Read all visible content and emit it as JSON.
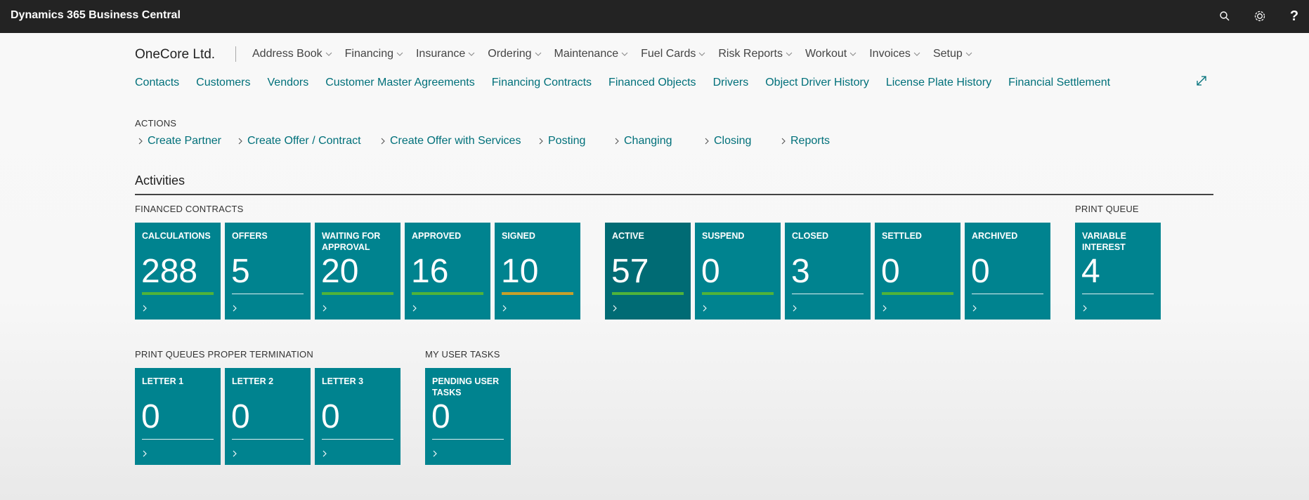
{
  "app": {
    "title": "Dynamics 365 Business Central"
  },
  "topbar": {
    "help": "?"
  },
  "company": "OneCore Ltd.",
  "menu": [
    {
      "label": "Address Book"
    },
    {
      "label": "Financing"
    },
    {
      "label": "Insurance"
    },
    {
      "label": "Ordering"
    },
    {
      "label": "Maintenance"
    },
    {
      "label": "Fuel Cards"
    },
    {
      "label": "Risk Reports"
    },
    {
      "label": "Workout"
    },
    {
      "label": "Invoices"
    },
    {
      "label": "Setup"
    }
  ],
  "navlinks": [
    "Contacts",
    "Customers",
    "Vendors",
    "Customer Master Agreements",
    "Financing Contracts",
    "Financed Objects",
    "Drivers",
    "Object Driver History",
    "License Plate History",
    "Financial Settlement"
  ],
  "actions": {
    "title": "ACTIONS",
    "items": [
      "Create Partner",
      "Create Offer / Contract",
      "Create Offer with Services",
      "Posting",
      "Changing",
      "Closing",
      "Reports"
    ]
  },
  "activities": {
    "title": "Activities",
    "groups": {
      "financed": "FINANCED CONTRACTS",
      "print_queue": "PRINT QUEUE",
      "termination": "PRINT QUEUES PROPER TERMINATION",
      "user_tasks": "MY USER TASKS"
    },
    "tiles": [
      {
        "label": "CALCULATIONS",
        "value": "288",
        "bar": "green"
      },
      {
        "label": "OFFERS",
        "value": "5",
        "bar": "plain"
      },
      {
        "label": "WAITING FOR APPROVAL",
        "value": "20",
        "bar": "green"
      },
      {
        "label": "APPROVED",
        "value": "16",
        "bar": "green"
      },
      {
        "label": "SIGNED",
        "value": "10",
        "bar": "yellow"
      },
      {
        "label": "ACTIVE",
        "value": "57",
        "bar": "green"
      },
      {
        "label": "SUSPEND",
        "value": "0",
        "bar": "green"
      },
      {
        "label": "CLOSED",
        "value": "3",
        "bar": "plain"
      },
      {
        "label": "SETTLED",
        "value": "0",
        "bar": "green"
      },
      {
        "label": "ARCHIVED",
        "value": "0",
        "bar": "plain"
      },
      {
        "label": "VARIABLE INTEREST",
        "value": "4",
        "bar": "plain"
      },
      {
        "label": "LETTER 1",
        "value": "0",
        "bar": "plain"
      },
      {
        "label": "LETTER 2",
        "value": "0",
        "bar": "plain"
      },
      {
        "label": "LETTER 3",
        "value": "0",
        "bar": "plain"
      },
      {
        "label": "PENDING USER TASKS",
        "value": "0",
        "bar": "plain"
      }
    ]
  },
  "colors": {
    "topbar": "#232323",
    "tile": "#00838f",
    "tile_active": "#006b74",
    "link": "#00707a",
    "bar_green": "#4fb33a",
    "bar_yellow": "#c6a02a"
  }
}
